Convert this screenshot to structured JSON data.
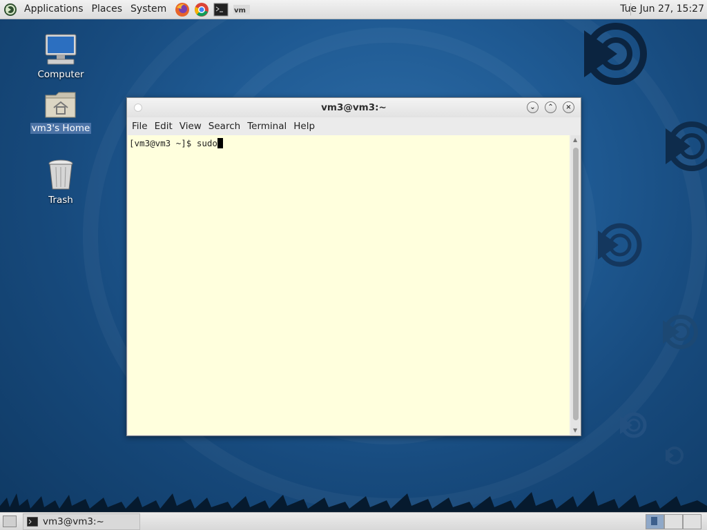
{
  "top_panel": {
    "menus": [
      "Applications",
      "Places",
      "System"
    ],
    "launchers": [
      "firefox-icon",
      "chrome-icon",
      "terminal-icon",
      "vmware-icon"
    ],
    "clock": "Tue Jun 27, 15:27"
  },
  "desktop": {
    "icons": [
      {
        "label": "Computer",
        "icon": "computer-icon"
      },
      {
        "label": "vm3's Home",
        "icon": "home-folder-icon",
        "selected": true
      },
      {
        "label": "Trash",
        "icon": "trash-icon"
      }
    ]
  },
  "terminal": {
    "title": "vm3@vm3:~",
    "menu": [
      "File",
      "Edit",
      "View",
      "Search",
      "Terminal",
      "Help"
    ],
    "prompt": "[vm3@vm3 ~]$ ",
    "command": "sudo"
  },
  "taskbar": {
    "task_label": "vm3@vm3:~"
  },
  "colors": {
    "terminal_bg": "#ffffdd",
    "desktop_bg": "#1f5a93",
    "panel_bg": "#e6e6e6"
  }
}
